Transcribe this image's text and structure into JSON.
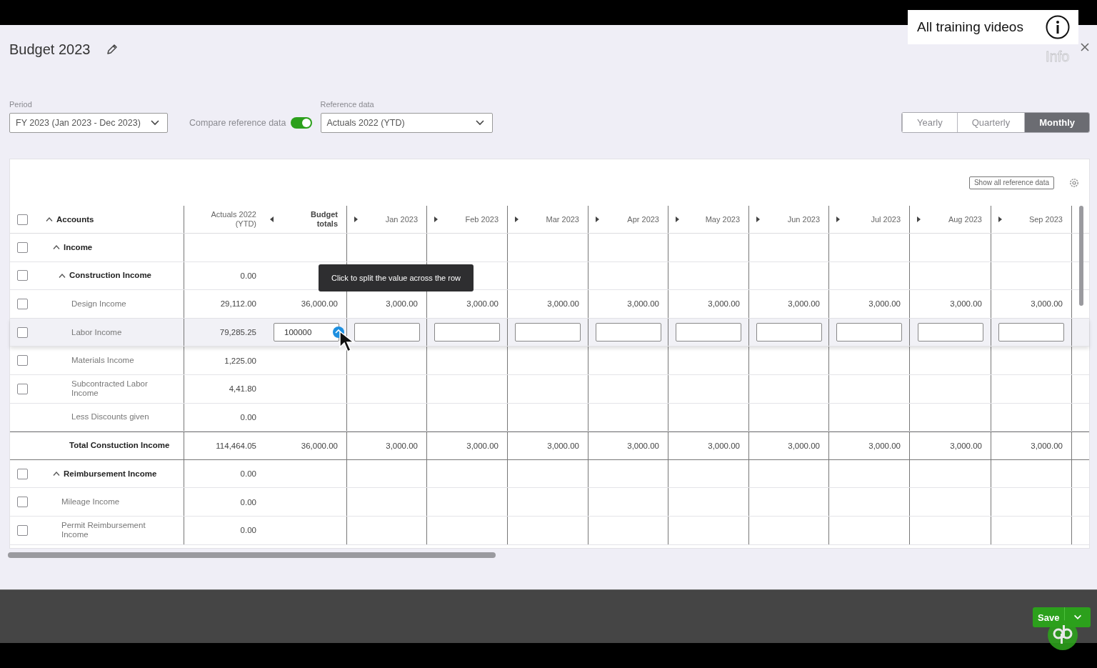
{
  "window": {
    "title": "Budget 2023"
  },
  "training_banner": {
    "label": "All training videos",
    "info_label": "Info"
  },
  "filters": {
    "period": {
      "label": "Period",
      "value": "FY 2023 (Jan 2023 - Dec 2023)"
    },
    "compare": {
      "label": "Compare reference data",
      "on": true
    },
    "reference": {
      "label": "Reference data",
      "value": "Actuals 2022 (YTD)"
    }
  },
  "view_tabs": [
    {
      "label": "Yearly",
      "selected": false
    },
    {
      "label": "Quarterly",
      "selected": false
    },
    {
      "label": "Monthly",
      "selected": true
    }
  ],
  "table": {
    "toolbar_button": "Show all reference data",
    "columns": [
      {
        "label": "Accounts",
        "kind": "accounts",
        "checked": false
      },
      {
        "label": "Actuals 2022 (YTD)",
        "kind": "plain"
      },
      {
        "label": "Budget totals",
        "kind": "collapse"
      },
      {
        "label": "Jan 2023",
        "kind": "expand"
      },
      {
        "label": "Feb 2023",
        "kind": "expand"
      },
      {
        "label": "Mar 2023",
        "kind": "expand"
      },
      {
        "label": "Apr 2023",
        "kind": "expand"
      },
      {
        "label": "May 2023",
        "kind": "expand"
      },
      {
        "label": "Jun 2023",
        "kind": "expand"
      },
      {
        "label": "Jul 2023",
        "kind": "expand"
      },
      {
        "label": "Aug 2023",
        "kind": "expand"
      },
      {
        "label": "Sep 2023",
        "kind": "expand"
      }
    ],
    "rows": [
      {
        "label": "Income",
        "kind": "group",
        "checked": false,
        "expanded": true,
        "selected": false,
        "cells": [],
        "children": [
          {
            "label": "Construction Income",
            "kind": "group",
            "checked": false,
            "expanded": true,
            "selected": false,
            "cells": [
              null,
              "0.00"
            ],
            "children": [
              {
                "label": "Design Income",
                "kind": "account",
                "checked": false,
                "selected": false,
                "cells": [
                  null,
                  "29,112.00",
                  "36,000.00",
                  "3,000.00",
                  "3,000.00",
                  "3,000.00",
                  "3,000.00",
                  "3,000.00",
                  "3,000.00",
                  "3,000.00",
                  "3,000.00",
                  "3,000.00"
                ]
              },
              {
                "label": "Labor Income",
                "kind": "account",
                "checked": false,
                "selected": true,
                "cells": [
                  null,
                  "79,285.25",
                  {
                    "kind": "input",
                    "value": "100000",
                    "split": true
                  },
                  {
                    "kind": "input"
                  },
                  {
                    "kind": "input"
                  },
                  {
                    "kind": "input"
                  },
                  {
                    "kind": "input"
                  },
                  {
                    "kind": "input"
                  },
                  {
                    "kind": "input"
                  },
                  {
                    "kind": "input"
                  },
                  {
                    "kind": "input"
                  },
                  {
                    "kind": "input"
                  }
                ]
              },
              {
                "label": "Materials Income",
                "kind": "account",
                "checked": false,
                "selected": false,
                "cells": [
                  null,
                  "1,225.00"
                ]
              },
              {
                "label": "Subcontracted Labor Income",
                "kind": "account",
                "checked": false,
                "selected": false,
                "cells": [
                  null,
                  "4,41.80"
                ]
              },
              {
                "label": "Less Discounts given",
                "kind": "account",
                "selected": false,
                "cells": [
                  null,
                  "0.00"
                ]
              }
            ]
          },
          {
            "label": "Total Constuction Income",
            "kind": "total",
            "selected": false,
            "cells": [
              null,
              "114,464.05",
              "36,000.00",
              "3,000.00",
              "3,000.00",
              "3,000.00",
              "3,000.00",
              "3,000.00",
              "3,000.00",
              "3,000.00",
              "3,000.00",
              "3,000.00"
            ]
          }
        ]
      },
      {
        "label": "Reimbursement Income",
        "kind": "group",
        "checked": false,
        "expanded": true,
        "selected": false,
        "cells": [
          null,
          "0.00"
        ],
        "children": [
          {
            "label": "Mileage Income",
            "kind": "account",
            "checked": false,
            "selected": false,
            "cells": [
              null,
              "0.00"
            ]
          },
          {
            "label": "Permit Reimbursement Income",
            "kind": "account",
            "checked": false,
            "selected": false,
            "cells": [
              null,
              "0.00"
            ]
          }
        ]
      }
    ]
  },
  "tooltip": {
    "text": "Click to split the value across the row"
  },
  "footer": {
    "save_label": "Save"
  }
}
